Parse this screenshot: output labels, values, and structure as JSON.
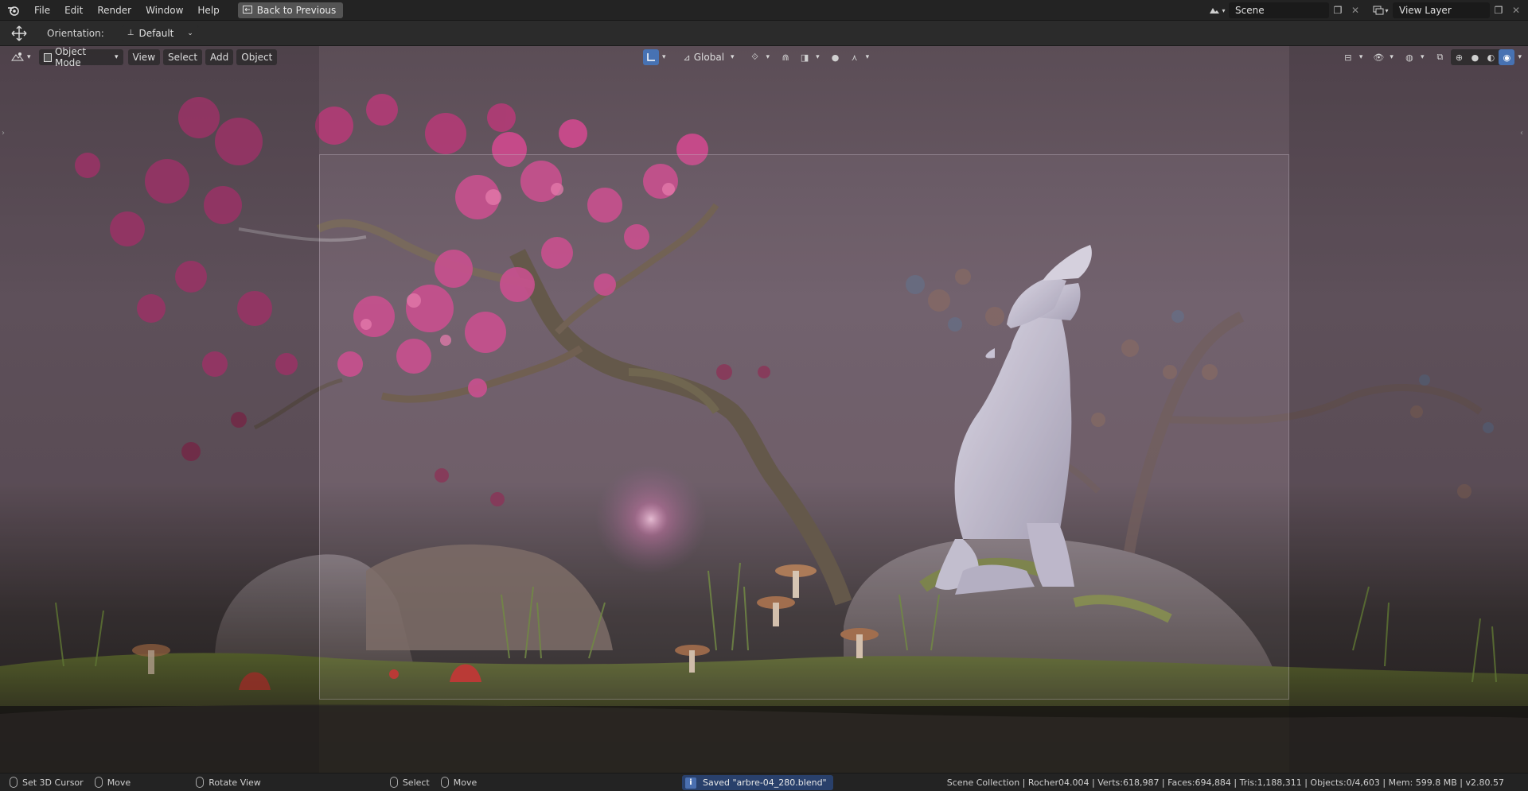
{
  "menu": {
    "items": [
      "File",
      "Edit",
      "Render",
      "Window",
      "Help"
    ],
    "back_button": "Back to Previous"
  },
  "topbar_right": {
    "scene": "Scene",
    "view_layer": "View Layer"
  },
  "tool_settings": {
    "orientation_label": "Orientation:",
    "orientation_value": "Default"
  },
  "viewport_header": {
    "mode": "Object Mode",
    "menus": [
      "View",
      "Select",
      "Add",
      "Object"
    ],
    "transform_orientation": "Global"
  },
  "statusbar": {
    "hint1": "Set 3D Cursor",
    "hint2": "Move",
    "hint3": "Rotate View",
    "hint4": "Select",
    "hint5": "Move",
    "saved_message": "Saved \"arbre-04_280.blend\"",
    "stats": "Scene Collection | Rocher04.004 | Verts:618,987 | Faces:694,884 | Tris:1,188,311 | Objects:0/4,603 | Mem: 599.8 MB | v2.80.57"
  },
  "colors": {
    "accent": "#4772b3",
    "saved_bg": "#29406b",
    "blossom": "#c0407a"
  },
  "icons": [
    "blender-logo-icon",
    "screen-back-icon",
    "scene-icon",
    "view-layer-icon",
    "move-tool-icon",
    "object-mode-icon",
    "editor-type-icon",
    "gizmo-icon",
    "global-orient-icon",
    "pivot-icon",
    "snap-icon",
    "proportional-icon",
    "visibility-icon",
    "overlay-icon",
    "xray-icon",
    "wireframe-shading-icon",
    "solid-shading-icon",
    "material-shading-icon",
    "rendered-shading-icon"
  ]
}
